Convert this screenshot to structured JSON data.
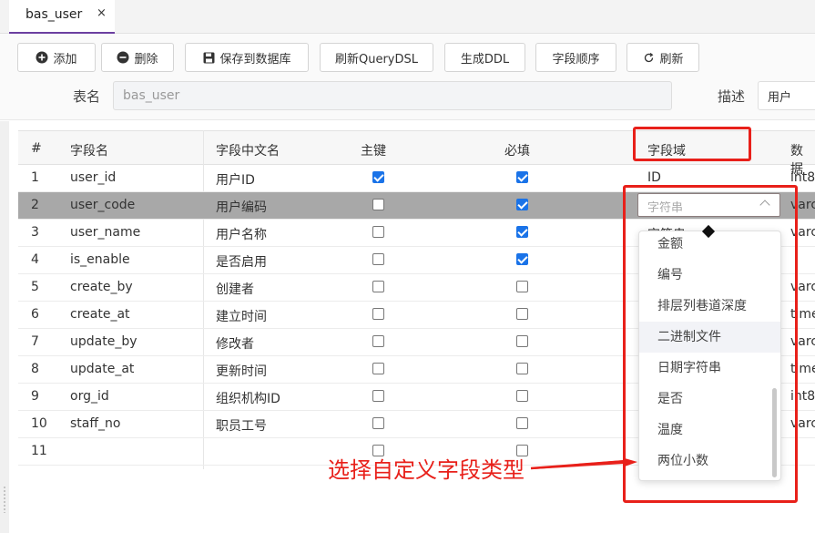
{
  "tab": {
    "label": "bas_user",
    "close": "×"
  },
  "toolbar": {
    "add": "添加",
    "delete": "删除",
    "save_db": "保存到数据库",
    "refresh_querydsl": "刷新QueryDSL",
    "gen_ddl": "生成DDL",
    "field_order": "字段顺序",
    "refresh": "刷新"
  },
  "form": {
    "table_label": "表名",
    "table_value": "bas_user",
    "desc_label": "描述",
    "desc_value": "用户"
  },
  "grid": {
    "headers": [
      "#",
      "字段名",
      "字段中文名",
      "主键",
      "必填",
      "字段域",
      "数据"
    ],
    "rows": [
      {
        "num": "1",
        "name": "user_id",
        "cn": "用户ID",
        "pk": true,
        "req": true,
        "domain": "ID",
        "dtype": "int8"
      },
      {
        "num": "2",
        "name": "user_code",
        "cn": "用户编码",
        "pk": false,
        "req": true,
        "domain": "",
        "dtype": "varc"
      },
      {
        "num": "3",
        "name": "user_name",
        "cn": "用户名称",
        "pk": false,
        "req": true,
        "domain": "字符串",
        "dtype": "varc"
      },
      {
        "num": "4",
        "name": "is_enable",
        "cn": "是否启用",
        "pk": false,
        "req": true,
        "domain": "",
        "dtype": ""
      },
      {
        "num": "5",
        "name": "create_by",
        "cn": "创建者",
        "pk": false,
        "req": false,
        "domain": "",
        "dtype": "varc"
      },
      {
        "num": "6",
        "name": "create_at",
        "cn": "建立时间",
        "pk": false,
        "req": false,
        "domain": "",
        "dtype": "time"
      },
      {
        "num": "7",
        "name": "update_by",
        "cn": "修改者",
        "pk": false,
        "req": false,
        "domain": "",
        "dtype": "varc"
      },
      {
        "num": "8",
        "name": "update_at",
        "cn": "更新时间",
        "pk": false,
        "req": false,
        "domain": "",
        "dtype": "time"
      },
      {
        "num": "9",
        "name": "org_id",
        "cn": "组织机构ID",
        "pk": false,
        "req": false,
        "domain": "",
        "dtype": "int8"
      },
      {
        "num": "10",
        "name": "staff_no",
        "cn": "职员工号",
        "pk": false,
        "req": false,
        "domain": "",
        "dtype": "varc"
      },
      {
        "num": "11",
        "name": "",
        "cn": "",
        "pk": false,
        "req": false,
        "domain": "",
        "dtype": ""
      }
    ]
  },
  "combo": {
    "value": "字符串"
  },
  "dropdown": {
    "items": [
      "金额",
      "编号",
      "排层列巷道深度",
      "二进制文件",
      "日期字符串",
      "是否",
      "温度",
      "两位小数"
    ],
    "highlighted_index": 3
  },
  "annotation": {
    "text": "选择自定义字段类型",
    "color": "#e8201a"
  },
  "colors": {
    "accent": "#6b3fa0",
    "checkbox": "#1a73e8",
    "selected_row": "#a8a8a8"
  }
}
